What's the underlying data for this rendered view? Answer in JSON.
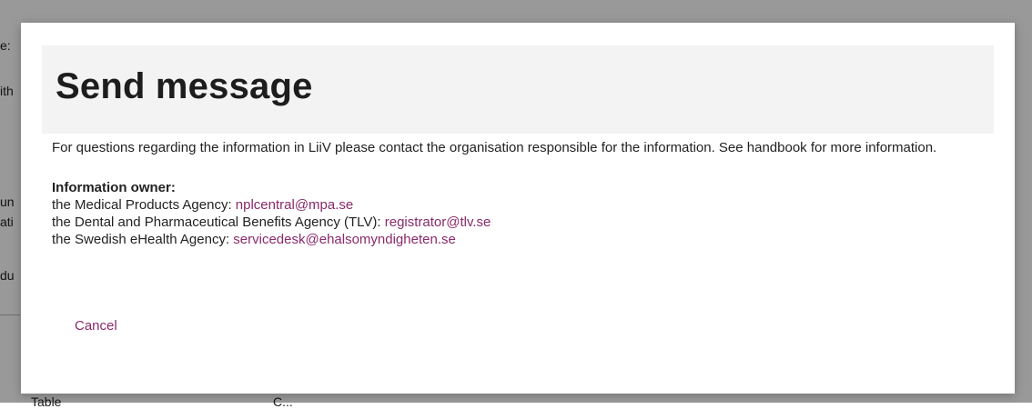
{
  "background": {
    "fragments": [
      {
        "text": "e:"
      },
      {
        "text": "ith"
      },
      {
        "text": "un"
      },
      {
        "text": "ati"
      },
      {
        "text": "du"
      },
      {
        "text": "Table"
      },
      {
        "text": "C..."
      }
    ]
  },
  "dialog": {
    "title": "Send message",
    "intro": "For questions regarding the information in LiiV please contact the organisation responsible for the information. See handbook for more information.",
    "owner_heading": "Information owner:",
    "owners": [
      {
        "label": "the Medical Products Agency: ",
        "email": "nplcentral@mpa.se"
      },
      {
        "label": "the Dental and Pharmaceutical Benefits Agency (TLV): ",
        "email": "registrator@tlv.se"
      },
      {
        "label": "the Swedish eHealth Agency: ",
        "email": "servicedesk@ehalsomyndigheten.se"
      }
    ],
    "cancel_label": "Cancel"
  },
  "colors": {
    "link": "#8a2a6b",
    "header_bg": "#f3f3f3",
    "overlay": "#000000"
  }
}
